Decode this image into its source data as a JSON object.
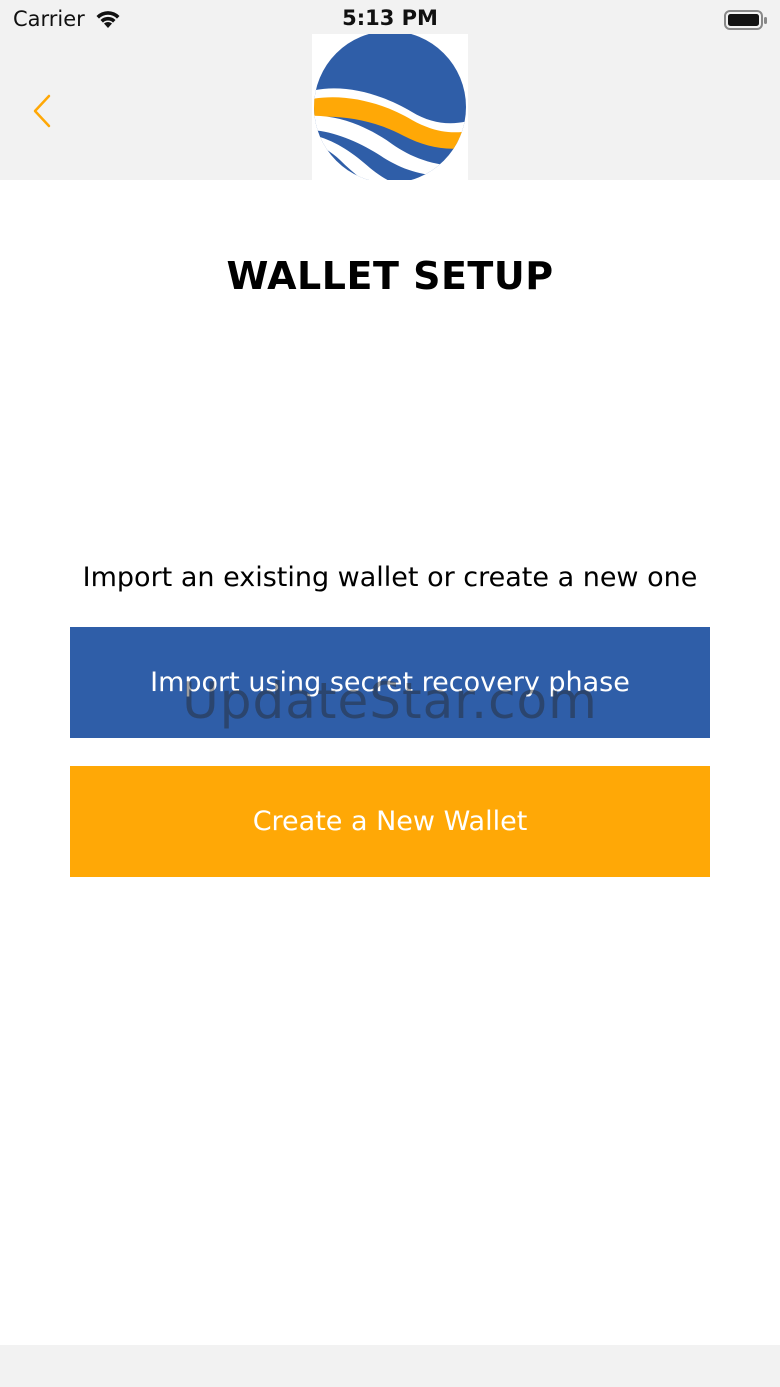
{
  "status_bar": {
    "carrier": "Carrier",
    "time": "5:13 PM",
    "wifi_icon": "wifi-icon",
    "battery_icon": "battery-icon"
  },
  "nav": {
    "back_icon": "chevron-left-icon",
    "logo_icon": "wave-globe-logo"
  },
  "main": {
    "title": "WALLET SETUP",
    "subtitle": "Import an existing wallet or create a new one",
    "import_button_label": "Import using secret recovery phase",
    "create_button_label": "Create a New Wallet",
    "watermark": "UpdateStar.com"
  },
  "colors": {
    "accent_orange": "#ffa806",
    "primary_blue": "#2f5ea8",
    "bar_gray": "#f2f2f2"
  }
}
